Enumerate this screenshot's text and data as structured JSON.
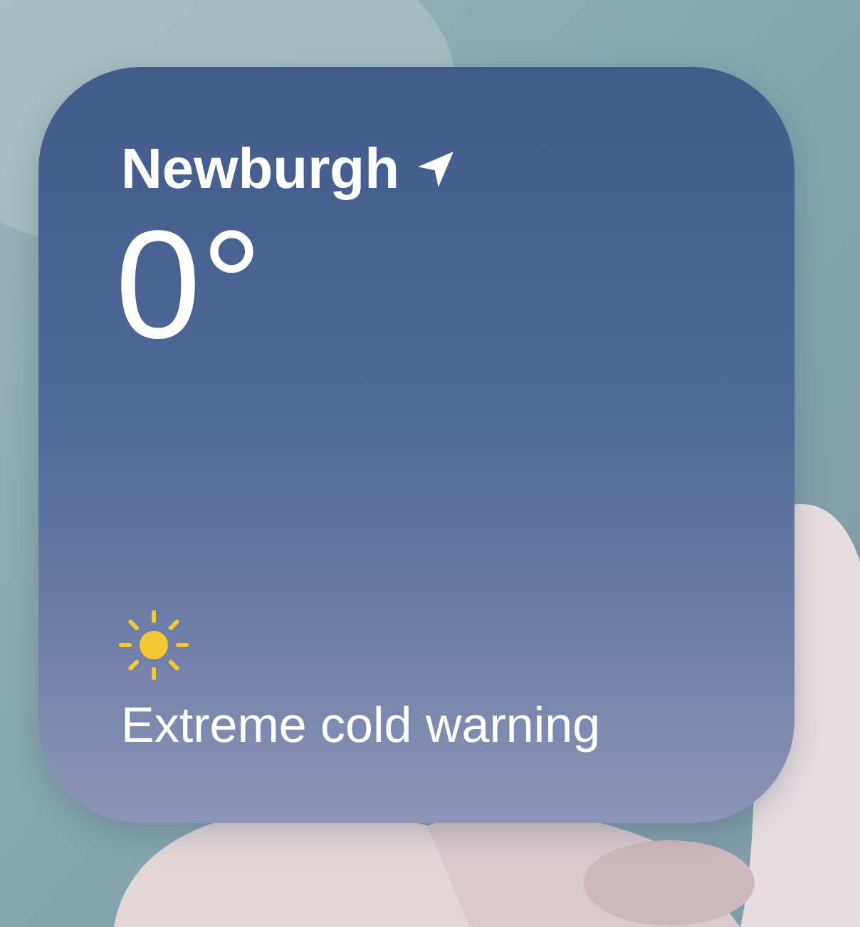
{
  "widget": {
    "city": "Newburgh",
    "temperature": "0°",
    "alert": "Extreme cold warning"
  }
}
